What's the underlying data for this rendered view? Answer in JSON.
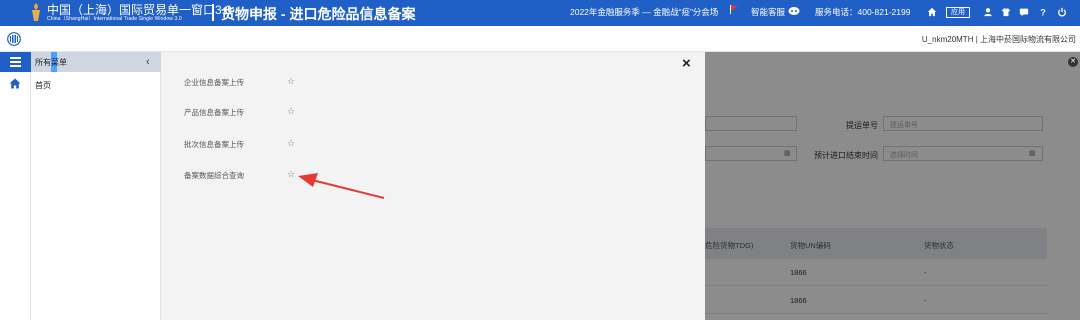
{
  "header": {
    "brand_cn": "中国（上海）国际贸易单一窗口3.0",
    "brand_en": "China（ShangHai）International Trade Single Window 3.0",
    "app_title": "货物申报 - 进口危险品信息备案",
    "promo": "2022年金融服务季 — 金融战“疫”分会场",
    "customer_service": "智能客服",
    "phone": "服务电话：400-821-2199",
    "app_badge": "应用",
    "icons": [
      "home-icon",
      "app-icon",
      "user-icon",
      "shirt-icon",
      "message-icon",
      "help-icon",
      "power-icon"
    ]
  },
  "subheader": {
    "user": "U_nkm20MTH | 上海中菸国际物流有限公司"
  },
  "sidebar": {
    "heading": "所有菜单",
    "items": [
      {
        "label": "首页"
      }
    ]
  },
  "panel": {
    "items": [
      {
        "label": "企业信息备案上传"
      },
      {
        "label": "产品信息备案上传"
      },
      {
        "label": "批次信息备案上传"
      },
      {
        "label": "备案数据综合查询"
      }
    ],
    "star": "☆",
    "close": "×"
  },
  "background_form": {
    "label_bill": "提运单号",
    "placeholder_bill": "提运单号",
    "label_date": "预计进口结束时间",
    "placeholder_date": "选择时间"
  },
  "background_table": {
    "headers": [
      "危险货物TDG)",
      "货物UN编码",
      "货物状态"
    ],
    "rows": [
      {
        "un": "1866",
        "status": "-"
      },
      {
        "un": "1866",
        "status": "-"
      }
    ]
  },
  "colors": {
    "brand_blue": "#1f5fc6",
    "arrow_red": "#e53935",
    "sidebar_head": "#cfd6e2"
  }
}
